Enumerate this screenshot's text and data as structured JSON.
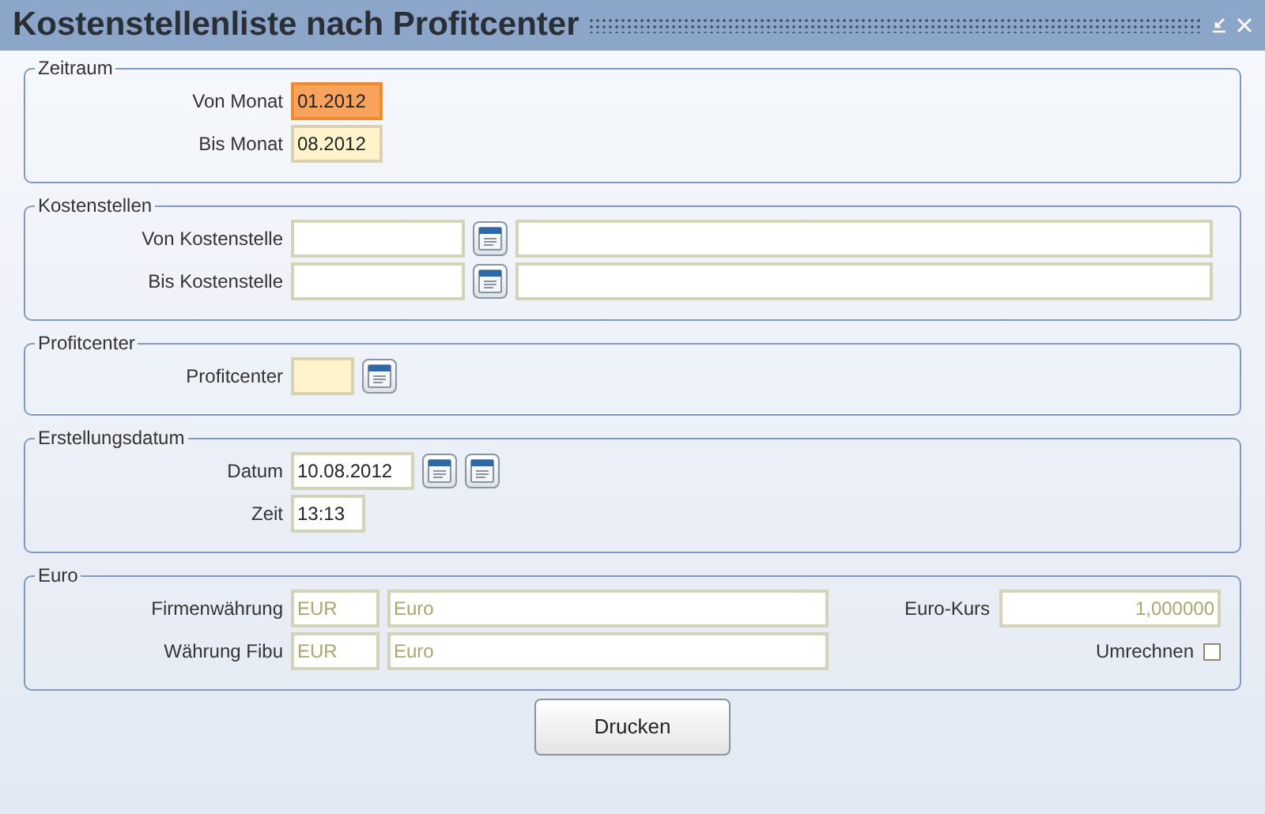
{
  "window": {
    "title": "Kostenstellenliste nach Profitcenter"
  },
  "sections": [
    {
      "title": "Zeitraum",
      "rows": [
        {
          "label": "Von Monat",
          "fields": [
            {
              "kind": "month",
              "value": "01.2012",
              "focused": true
            }
          ]
        },
        {
          "label": "Bis Monat",
          "fields": [
            {
              "kind": "month",
              "value": "08.2012",
              "focused": false,
              "required": true
            }
          ]
        }
      ]
    },
    {
      "title": "Kostenstellen",
      "rows": [
        {
          "label": "Von Kostenstelle",
          "fields": [
            {
              "kind": "code",
              "focused": false,
              "required": false
            },
            {
              "kind": "lookup"
            },
            {
              "kind": "description",
              "focused": false,
              "required": false
            }
          ]
        },
        {
          "label": "Bis Kostenstelle",
          "fields": [
            {
              "kind": "code",
              "focused": false,
              "required": false
            },
            {
              "kind": "lookup"
            },
            {
              "kind": "description",
              "focused": false,
              "required": false
            }
          ]
        }
      ]
    },
    {
      "title": "Profitcenter",
      "rows": [
        {
          "label": "Profitcenter",
          "fields": [
            {
              "kind": "short",
              "focused": false,
              "required": true
            },
            {
              "kind": "lookup"
            }
          ]
        }
      ]
    },
    {
      "title": "Erstellungsdatum",
      "rows": [
        {
          "label": "Datum",
          "fields": [
            {
              "kind": "date",
              "value": "10.08.2012",
              "focused": false,
              "required": false
            },
            {
              "kind": "lookup"
            },
            {
              "kind": "lookup"
            }
          ]
        },
        {
          "label": "Zeit",
          "fields": [
            {
              "kind": "time",
              "value": "13:13",
              "focused": false,
              "required": false
            }
          ]
        }
      ]
    },
    {
      "title": "Euro",
      "rows": [
        {
          "label": "Firmenwährung",
          "fields": [
            {
              "kind": "currency",
              "value": "EUR",
              "disabled": true
            },
            {
              "kind": "name",
              "value": "Euro",
              "disabled": true
            }
          ],
          "side": {
            "kind": "rate",
            "label": "Euro-Kurs",
            "value": "1,000000",
            "disabled": true
          }
        },
        {
          "label": "Währung Fibu",
          "fields": [
            {
              "kind": "currency",
              "value": "EUR",
              "disabled": true
            },
            {
              "kind": "name",
              "value": "Euro",
              "disabled": true
            }
          ],
          "side": {
            "kind": "checkbox",
            "label": "Umrechnen",
            "checked": false
          }
        }
      ]
    }
  ],
  "buttons": [
    "Drucken"
  ]
}
